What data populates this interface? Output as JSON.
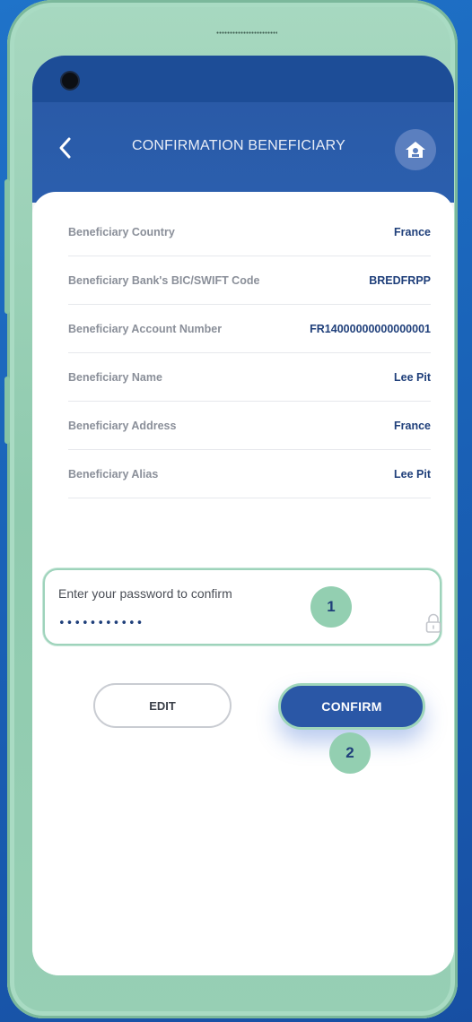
{
  "header": {
    "title": "CONFIRMATION BENEFICIARY",
    "back_icon": "chevron-left-icon",
    "home_icon": "home-icon"
  },
  "details": [
    {
      "label": "Beneficiary Country",
      "value": "France"
    },
    {
      "label": "Beneficiary Bank's BIC/SWIFT Code",
      "value": "BREDFRPP"
    },
    {
      "label": "Beneficiary Account Number",
      "value": "FR14000000000000001"
    },
    {
      "label": "Beneficiary Name",
      "value": "Lee Pit"
    },
    {
      "label": "Beneficiary Address",
      "value": "France"
    },
    {
      "label": "Beneficiary Alias",
      "value": "Lee Pit"
    }
  ],
  "password": {
    "label": "Enter your password to confirm",
    "value": "•••••••••••",
    "icon": "lock-icon"
  },
  "badges": {
    "step1": "1",
    "step2": "2"
  },
  "actions": {
    "edit_label": "EDIT",
    "confirm_label": "CONFIRM"
  },
  "colors": {
    "primary": "#2a57a6",
    "accent": "#93cfb1",
    "value_text": "#1f3f7a"
  }
}
